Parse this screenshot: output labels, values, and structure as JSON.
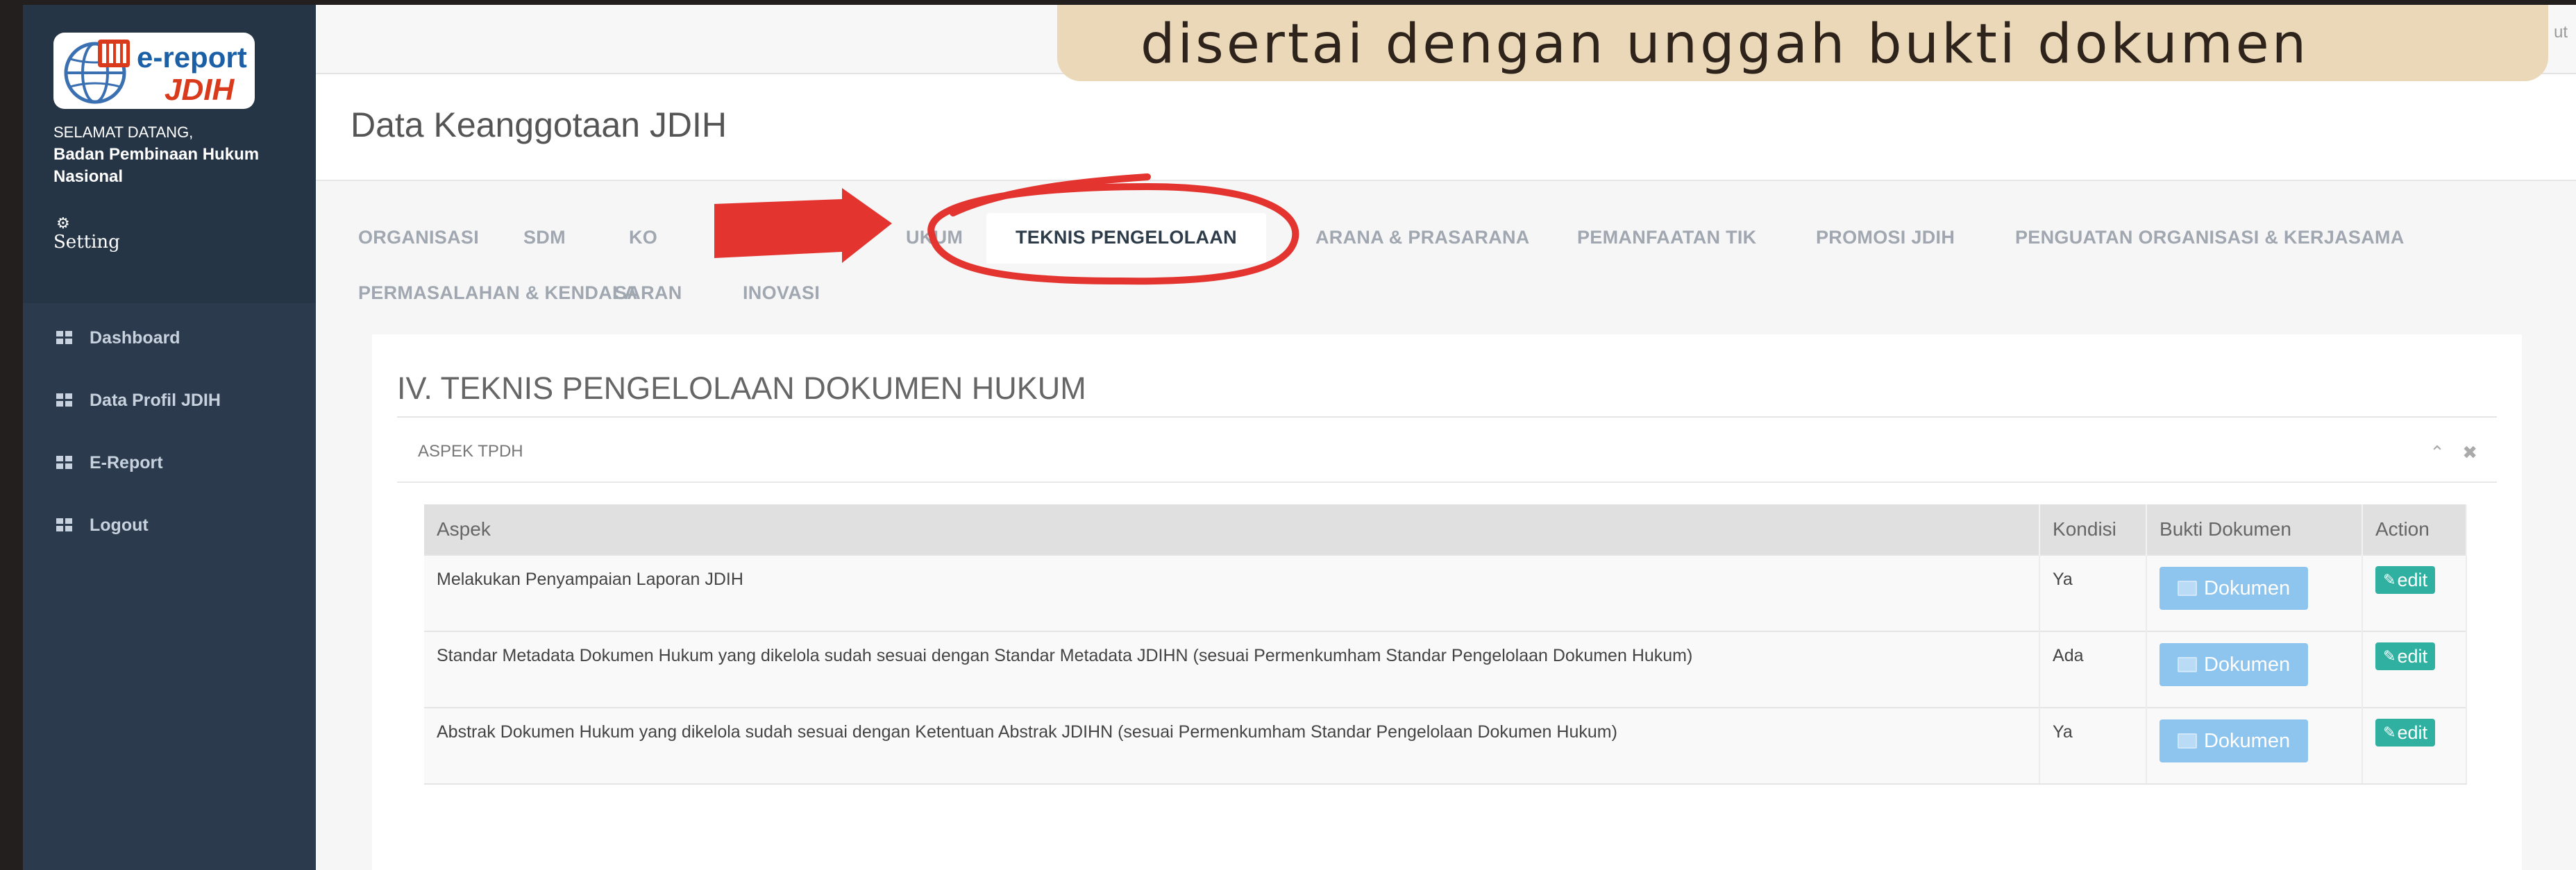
{
  "caption": "disertai dengan unggah bukti dokumen",
  "header": {
    "logout_partial": "ut",
    "page_title": "Data Keanggotaan JDIH"
  },
  "sidebar": {
    "logo_line1": "e-report",
    "logo_line2": "JDIH",
    "welcome_greeting": "SELAMAT DATANG,",
    "welcome_org": "Badan Pembinaan Hukum Nasional",
    "setting_label": "Setting",
    "items": [
      {
        "label": "Dashboard",
        "icon": "grid-icon"
      },
      {
        "label": "Data Profil JDIH",
        "icon": "grid-icon"
      },
      {
        "label": "E-Report",
        "icon": "grid-icon"
      },
      {
        "label": "Logout",
        "icon": "grid-icon"
      }
    ]
  },
  "tabs": [
    {
      "label": "ORGANISASI"
    },
    {
      "label": "SDM"
    },
    {
      "label": "KO"
    },
    {
      "label": "UKUM"
    },
    {
      "label": "TEKNIS PENGELOLAAN",
      "active": true
    },
    {
      "label": "ARANA & PRASARANA"
    },
    {
      "label": "PEMANFAATAN TIK"
    },
    {
      "label": "PROMOSI JDIH"
    },
    {
      "label": "PENGUATAN ORGANISASI & KERJASAMA"
    },
    {
      "label": "PERMASALAHAN & KENDALA"
    },
    {
      "label": "SARAN"
    },
    {
      "label": "INOVASI"
    }
  ],
  "section": {
    "title": "IV. TEKNIS PENGELOLAAN DOKUMEN HUKUM",
    "subpanel_label": "ASPEK TPDH",
    "tools": [
      "chevron-up-icon",
      "close-icon"
    ]
  },
  "table": {
    "headers": [
      "Aspek",
      "Kondisi",
      "Bukti Dokumen",
      "Action"
    ],
    "rows": [
      {
        "aspek": "Melakukan Penyampaian Laporan JDIH",
        "kondisi": "Ya",
        "doc_label": "Dokumen",
        "action_label": "edit"
      },
      {
        "aspek": "Standar Metadata Dokumen Hukum yang dikelola sudah sesuai dengan Standar Metadata JDIHN (sesuai Permenkumham Standar Pengelolaan Dokumen Hukum)",
        "kondisi": "Ada",
        "doc_label": "Dokumen",
        "action_label": "edit"
      },
      {
        "aspek": "Abstrak Dokumen Hukum yang dikelola sudah sesuai dengan Ketentuan Abstrak JDIHN (sesuai Permenkumham Standar Pengelolaan Dokumen Hukum)",
        "kondisi": "Ya",
        "doc_label": "Dokumen",
        "action_label": "edit"
      }
    ]
  },
  "colors": {
    "sidebar": "#2b3a4c",
    "accent_doc": "#8dc5ef",
    "accent_edit": "#2fb0a0",
    "annotation_red": "#e3342f",
    "caption_bg": "#ead8b8"
  }
}
